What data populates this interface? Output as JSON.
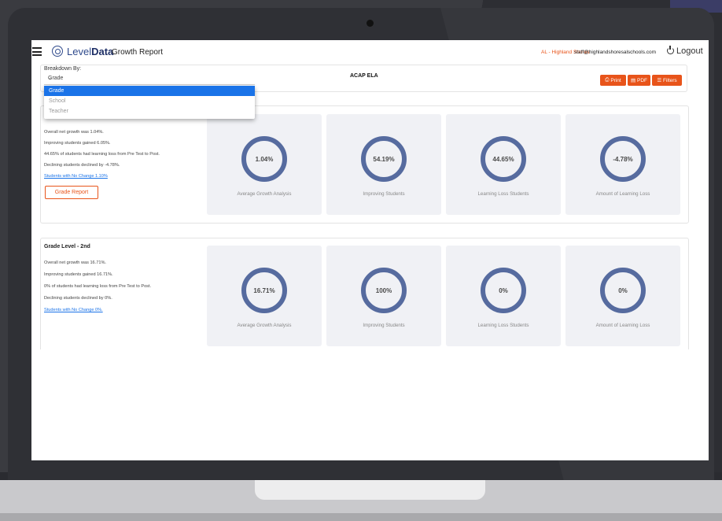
{
  "app": {
    "logo_light": "Level",
    "logo_bold": "Data",
    "title": "Growth Report",
    "district": "AL - Highland Shores",
    "user_email": "staff@highlandshoresalschools.com",
    "logout_label": "Logout"
  },
  "toolbar": {
    "breakdown_label": "Breakdown By:",
    "selected": "Grade",
    "subject": "ACAP ELA",
    "print_label": "Print",
    "pdf_label": "PDF",
    "filters_label": "Filters"
  },
  "dropdown": {
    "options": [
      "Grade",
      "School",
      "Teacher"
    ],
    "selected_index": 0
  },
  "cards": [
    {
      "heading": "",
      "lines": [
        "Overall net growth was 1.04%.",
        "Improving students gained 6.05%.",
        "44.65% of students had learning loss from Pre Test to Post.",
        "Declining students declined by -4.78%."
      ],
      "link": "Students with No Change 1.10%",
      "button": "Grade Report",
      "metrics": [
        {
          "value": "1.04%",
          "label": "Average Growth Analysis"
        },
        {
          "value": "54.19%",
          "label": "Improving Students"
        },
        {
          "value": "44.65%",
          "label": "Learning Loss Students"
        },
        {
          "value": "-4.78%",
          "label": "Amount of Learning Loss"
        }
      ]
    },
    {
      "heading": "Grade Level - 2nd",
      "lines": [
        "Overall net growth was 16.71%.",
        "Improving students gained 16.71%.",
        "0% of students had learning loss from Pre Test to Post.",
        "Declining students declined by 0%."
      ],
      "link": "Students with No Change 0%.",
      "metrics": [
        {
          "value": "16.71%",
          "label": "Average Growth Analysis"
        },
        {
          "value": "100%",
          "label": "Improving Students"
        },
        {
          "value": "0%",
          "label": "Learning Loss Students"
        },
        {
          "value": "0%",
          "label": "Amount of Learning Loss"
        }
      ]
    }
  ],
  "colors": {
    "accent": "#e8541a",
    "ring": "#566b9f",
    "link": "#1a73e8",
    "brand": "#2f4a8c"
  },
  "icons": [
    "menu-icon",
    "leveldata-logo-icon",
    "power-icon",
    "printer-icon",
    "pdf-icon",
    "filter-icon",
    "chevron-down-icon"
  ]
}
